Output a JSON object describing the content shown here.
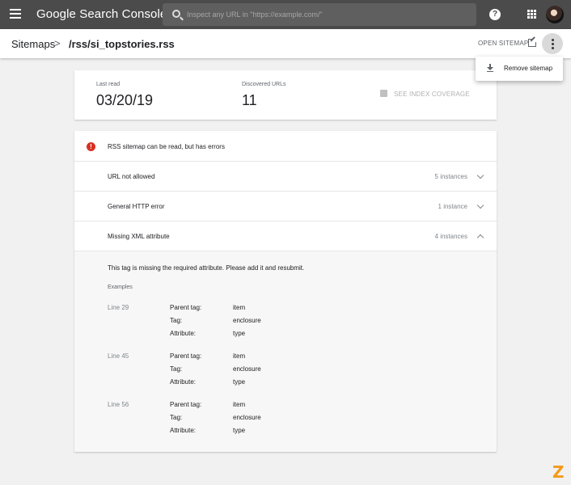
{
  "topbar": {
    "title": "Google Search Console",
    "search_placeholder": "Inspect any URL in \"https://example.com/\"",
    "help_glyph": "?"
  },
  "subbar": {
    "breadcrumb_root": "Sitemaps",
    "breadcrumb_sep": ">",
    "breadcrumb_current": "/rss/si_topstories.rss",
    "open_sitemap": "OPEN SITEMAP"
  },
  "menu": {
    "remove_label": "Remove sitemap"
  },
  "stats": {
    "last_read_label": "Last read",
    "last_read_value": "03/20/19",
    "discovered_label": "Discovered URLs",
    "discovered_value": "11",
    "coverage_label": "SEE INDEX COVERAGE"
  },
  "errors": {
    "status_glyph": "!",
    "title": "RSS sitemap can be read, but has errors",
    "status_color": "#d93025",
    "rows": [
      {
        "label": "URL not allowed",
        "count": "5 instances",
        "expanded": false
      },
      {
        "label": "General HTTP error",
        "count": "1 instance",
        "expanded": false
      },
      {
        "label": "Missing XML attribute",
        "count": "4 instances",
        "expanded": true
      }
    ],
    "detail": {
      "message": "This tag is missing the required attribute. Please add it and resubmit.",
      "examples_heading": "Examples",
      "keys": [
        "Parent tag:",
        "Tag:",
        "Attribute:"
      ],
      "examples": [
        {
          "line": "Line 29",
          "values": [
            "item",
            "enclosure",
            "type"
          ]
        },
        {
          "line": "Line 45",
          "values": [
            "item",
            "enclosure",
            "type"
          ]
        },
        {
          "line": "Line 56",
          "values": [
            "item",
            "enclosure",
            "type"
          ]
        }
      ]
    }
  },
  "brand_mark": "Z"
}
